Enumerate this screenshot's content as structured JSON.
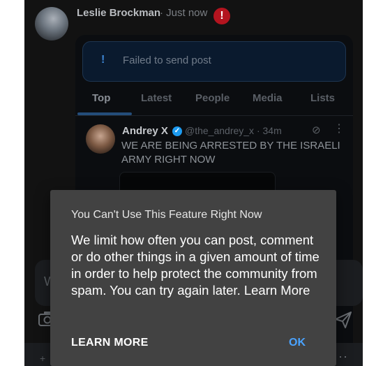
{
  "post": {
    "author": "Leslie Brockman",
    "meta": " · Just now",
    "error_badge": "!"
  },
  "banner": {
    "icon": "!",
    "text": "Failed to send post"
  },
  "tabs": [
    {
      "label": "Top"
    },
    {
      "label": "Latest"
    },
    {
      "label": "People"
    },
    {
      "label": "Media"
    },
    {
      "label": "Lists"
    }
  ],
  "tweet": {
    "name": "Andrey X",
    "handle": "@the_andrey_x · 34m",
    "text": "WE ARE BEING ARRESTED BY THE ISRAELI ARMY RIGHT NOW"
  },
  "reply": {
    "placeholder_visible": "W"
  },
  "bottom": {
    "left_glyph": "+",
    "dots": "···"
  },
  "dialog": {
    "title": "You Can't Use This Feature Right Now",
    "body": "We limit how often you can post, comment or do other things in a given amount of time in order to help protect the community from spam. You can try again later. Learn More",
    "learn_more": "LEARN MORE",
    "ok": "OK"
  },
  "colors": {
    "accent": "#4aa3ff",
    "dialog_bg": "#424242",
    "error": "#b3141f",
    "app_bg": "#121212"
  }
}
